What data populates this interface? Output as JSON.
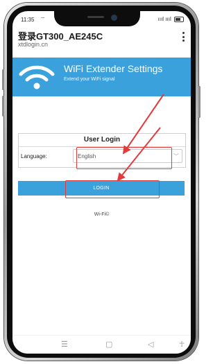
{
  "status_bar": {
    "time": "11:35",
    "wifi_glyph": "⌔",
    "signal_text": "ıııl ıııl"
  },
  "browser": {
    "title": "登录GT300_AE245C",
    "url": "xtdlogin.cn",
    "menu_icon": "more-vert-icon"
  },
  "banner": {
    "title": "WiFi Extender Settings",
    "subtitle": "Extend your WiFi signal",
    "icon": "wifi-icon",
    "color": "#3aa1dc"
  },
  "login": {
    "heading": "User Login",
    "language_label": "Language:",
    "language_value": "English",
    "button_label": "LOGIN"
  },
  "footer": {
    "text": "Wi-Fi©"
  },
  "nav": {
    "menu": "☰",
    "home": "▢",
    "back": "◁",
    "accessibility": "☥"
  },
  "annotation_color": "#e23b3b"
}
